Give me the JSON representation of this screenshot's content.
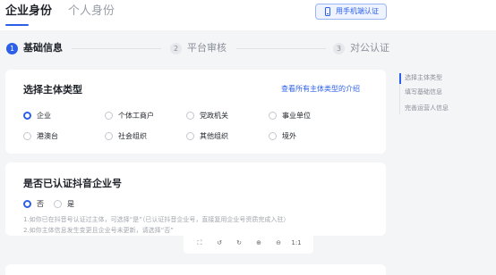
{
  "header": {
    "tabs": [
      {
        "label": "企业身份",
        "active": true
      },
      {
        "label": "个人身份",
        "active": false
      }
    ],
    "mobile_button": {
      "label": "用手机端认证",
      "icon": "mobile-phone-icon"
    }
  },
  "stepper": {
    "steps": [
      {
        "number": "1",
        "label": "基础信息",
        "active": true
      },
      {
        "number": "2",
        "label": "平台审核",
        "active": false
      },
      {
        "number": "3",
        "label": "对公认证",
        "active": false
      }
    ]
  },
  "subject_type": {
    "title": "选择主体类型",
    "link": "查看所有主体类型的介绍",
    "options": [
      {
        "label": "企业",
        "checked": true
      },
      {
        "label": "个体工商户",
        "checked": false
      },
      {
        "label": "党政机关",
        "checked": false
      },
      {
        "label": "事业单位",
        "checked": false
      },
      {
        "label": "港澳台",
        "checked": false
      },
      {
        "label": "社会组织",
        "checked": false
      },
      {
        "label": "其他组织",
        "checked": false
      },
      {
        "label": "境外",
        "checked": false
      }
    ]
  },
  "certified": {
    "title": "是否已认证抖音企业号",
    "options": [
      {
        "label": "否",
        "checked": true
      },
      {
        "label": "是",
        "checked": false
      }
    ],
    "help": [
      "1.如你已在抖音号认证过主体，可选择“是”（已认证抖音企业号，直接复用企业号资质完成入驻）",
      "2.如你主体信息发生变更且企业号未更新，请选择“否”"
    ]
  },
  "side_nav": {
    "items": [
      {
        "label": "选择主体类型",
        "active": true
      },
      {
        "label": "填写基础信息",
        "active": false
      },
      {
        "label": "完善运营人信息",
        "active": false
      }
    ]
  },
  "toolbar": {
    "tools": [
      {
        "icon": "fullscreen-icon",
        "glyph": "⛶"
      },
      {
        "icon": "rotate-left-icon",
        "glyph": "↺"
      },
      {
        "icon": "rotate-right-icon",
        "glyph": "↻"
      },
      {
        "icon": "zoom-in-icon",
        "glyph": "⊕"
      },
      {
        "icon": "zoom-out-icon",
        "glyph": "⊖"
      },
      {
        "icon": "actual-size-icon",
        "glyph": "1:1"
      }
    ]
  },
  "colors": {
    "accent": "#2b5fe8",
    "background": "#f4f5f7",
    "muted_text": "#8a8f99"
  }
}
